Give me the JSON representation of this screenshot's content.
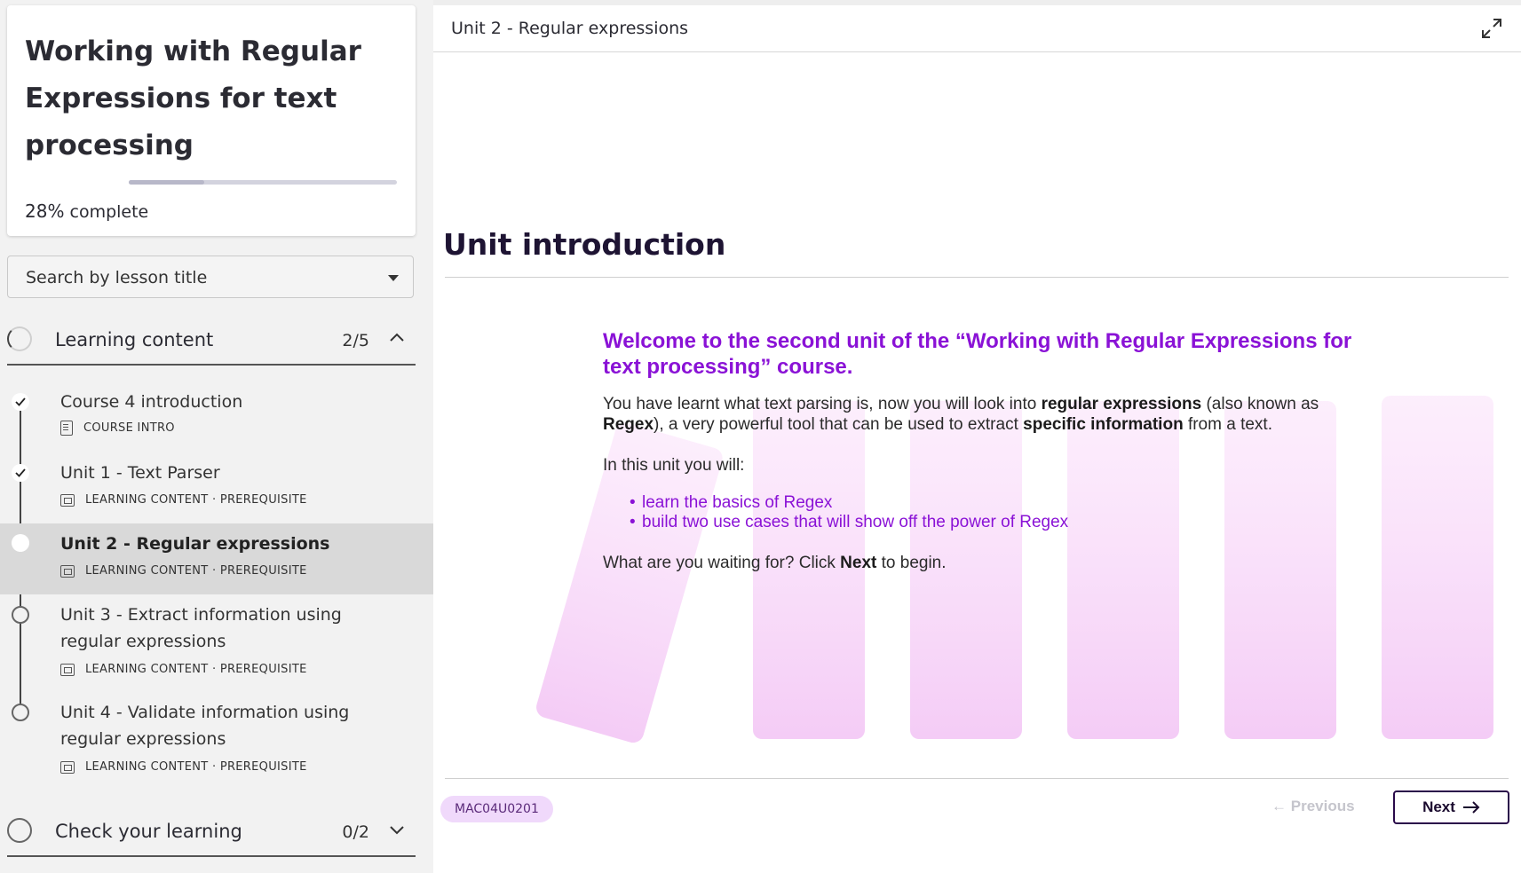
{
  "course": {
    "title": "Working with Regular Expressions for text processing",
    "progress_percent": "28%",
    "progress_value": 0.28,
    "progress_label": " complete"
  },
  "search": {
    "placeholder": "Search by lesson title"
  },
  "sections": [
    {
      "title": "Learning content",
      "count": "2/5",
      "expanded": true,
      "lessons": [
        {
          "title": "Course 4 introduction",
          "meta": "COURSE INTRO",
          "status": "done",
          "icon": "document-icon"
        },
        {
          "title": "Unit 1 - Text Parser",
          "meta": "LEARNING CONTENT · PREREQUISITE",
          "status": "done",
          "icon": "slides-icon"
        },
        {
          "title": "Unit 2 - Regular expressions",
          "meta": "LEARNING CONTENT · PREREQUISITE",
          "status": "current",
          "icon": "slides-icon"
        },
        {
          "title": "Unit 3 - Extract information using regular expressions",
          "meta": "LEARNING CONTENT · PREREQUISITE",
          "status": "todo",
          "icon": "slides-icon"
        },
        {
          "title": "Unit 4 - Validate information using regular expressions",
          "meta": "LEARNING CONTENT · PREREQUISITE",
          "status": "todo",
          "icon": "slides-icon"
        }
      ]
    },
    {
      "title": "Check your learning",
      "count": "0/2",
      "expanded": false
    }
  ],
  "main": {
    "unit_title": "Unit 2 - Regular expressions",
    "heading": "Unit introduction",
    "welcome": "Welcome to the second unit of the “Working with Regular Expressions for text processing” course.",
    "para1": {
      "t1": "You have learnt what text parsing is, now you will look into ",
      "b1": "regular expressions",
      "t2": " (also known as ",
      "b2": "Regex",
      "t3": "), a very powerful tool that can be used to extract ",
      "b3": "specific information",
      "t4": " from a text."
    },
    "para2": "In this unit you will:",
    "bullets": [
      "learn the basics of Regex",
      "build two use cases that will show off the power of Regex"
    ],
    "para3": {
      "t1": "What are you waiting for? Click ",
      "b1": "Next",
      "t2": " to begin."
    },
    "code": "MAC04U0201",
    "prev_label": "Previous",
    "next_label": "Next",
    "accent_color": "#8a12d6"
  }
}
